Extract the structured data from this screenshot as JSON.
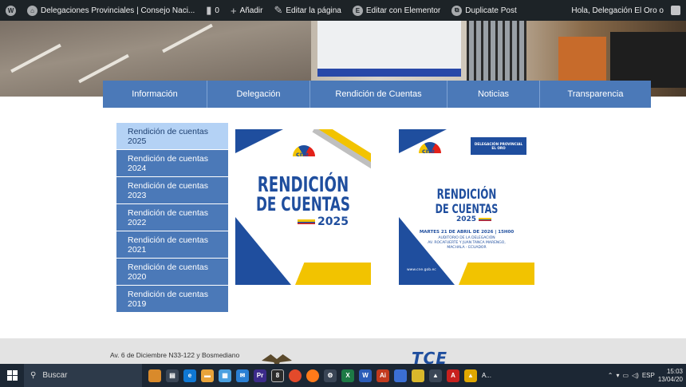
{
  "adminbar": {
    "site_name": "Delegaciones Provinciales | Consejo Naci...",
    "comments_count": "0",
    "add_new": "Añadir",
    "edit_page": "Editar la página",
    "edit_elementor": "Editar con Elementor",
    "duplicate_post": "Duplicate Post",
    "greeting": "Hola, Delegación El Oro o"
  },
  "nav": {
    "items": [
      {
        "label": "Información"
      },
      {
        "label": "Delegación"
      },
      {
        "label": "Rendición de Cuentas"
      },
      {
        "label": "Noticias"
      },
      {
        "label": "Transparencia"
      }
    ]
  },
  "sidemenu": {
    "items": [
      {
        "label": "Rendición de cuentas 2025",
        "active": true
      },
      {
        "label": "Rendición de cuentas 2024"
      },
      {
        "label": "Rendición de cuentas 2023"
      },
      {
        "label": "Rendición de cuentas 2022"
      },
      {
        "label": "Rendición de cuentas 2021"
      },
      {
        "label": "Rendición de cuentas 2020"
      },
      {
        "label": "Rendición de cuentas 2019"
      }
    ]
  },
  "poster1": {
    "logo": "cne",
    "line1": "RENDICIÓN",
    "line2": "DE CUENTAS",
    "year": "2025"
  },
  "poster2": {
    "logo": "cne",
    "header_line1": "DELEGACIÓN PROVINCIAL",
    "header_line2": "EL ORO",
    "line1": "RENDICIÓN",
    "line2": "DE CUENTAS",
    "year": "2025",
    "date": "MARTES 21 DE ABRIL DE 2026 | 15H00",
    "place1": "AUDITORIO DE LA DELEGACIÓN",
    "place2": "AV. ROCAFUERTE Y JUAN TANCA MARENGO,",
    "place3": "MACHALA - ECUADOR",
    "url": "www.cne.gob.ec"
  },
  "footer": {
    "address": "Av. 6 de Diciembre N33-122 y Bosmediano",
    "tce_logo": "TCE"
  },
  "taskbar": {
    "search_placeholder": "Buscar",
    "tray_app_label": "A...",
    "lang": "ESP",
    "time": "15:03",
    "date": "13/04/20"
  },
  "colors": {
    "nav_blue": "#4b79b8",
    "active_light_blue": "#b4d2f5",
    "cne_blue": "#1f4e9e",
    "cne_yellow": "#f2c300"
  }
}
